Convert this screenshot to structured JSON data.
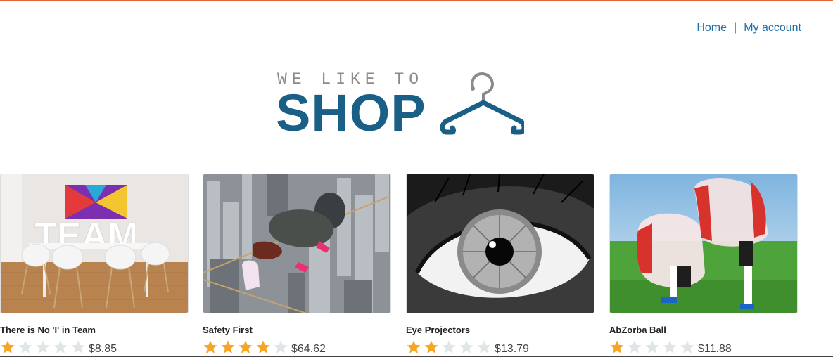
{
  "nav": {
    "home_label": "Home",
    "separator": "|",
    "account_label": "My account"
  },
  "logo": {
    "tagline": "WE LIKE TO",
    "word": "SHOP",
    "icon": "hanger-icon"
  },
  "colors": {
    "brand": "#1a5f86",
    "link": "#1f6fa8",
    "tagline": "#8a8a8a",
    "star_filled": "#f5a623",
    "star_empty": "#dfe5e8",
    "top_rule": "#e0663a"
  },
  "products": [
    {
      "title": "There is No 'I' in Team",
      "rating": 1,
      "max_rating": 5,
      "price": "$8.85",
      "image": "team-room-image"
    },
    {
      "title": "Safety First",
      "rating": 4,
      "max_rating": 5,
      "price": "$64.62",
      "image": "tightrope-city-image"
    },
    {
      "title": "Eye Projectors",
      "rating": 2,
      "max_rating": 5,
      "price": "$13.79",
      "image": "eye-closeup-image"
    },
    {
      "title": "AbZorba Ball",
      "rating": 1,
      "max_rating": 5,
      "price": "$11.88",
      "image": "bubble-ball-image"
    }
  ]
}
